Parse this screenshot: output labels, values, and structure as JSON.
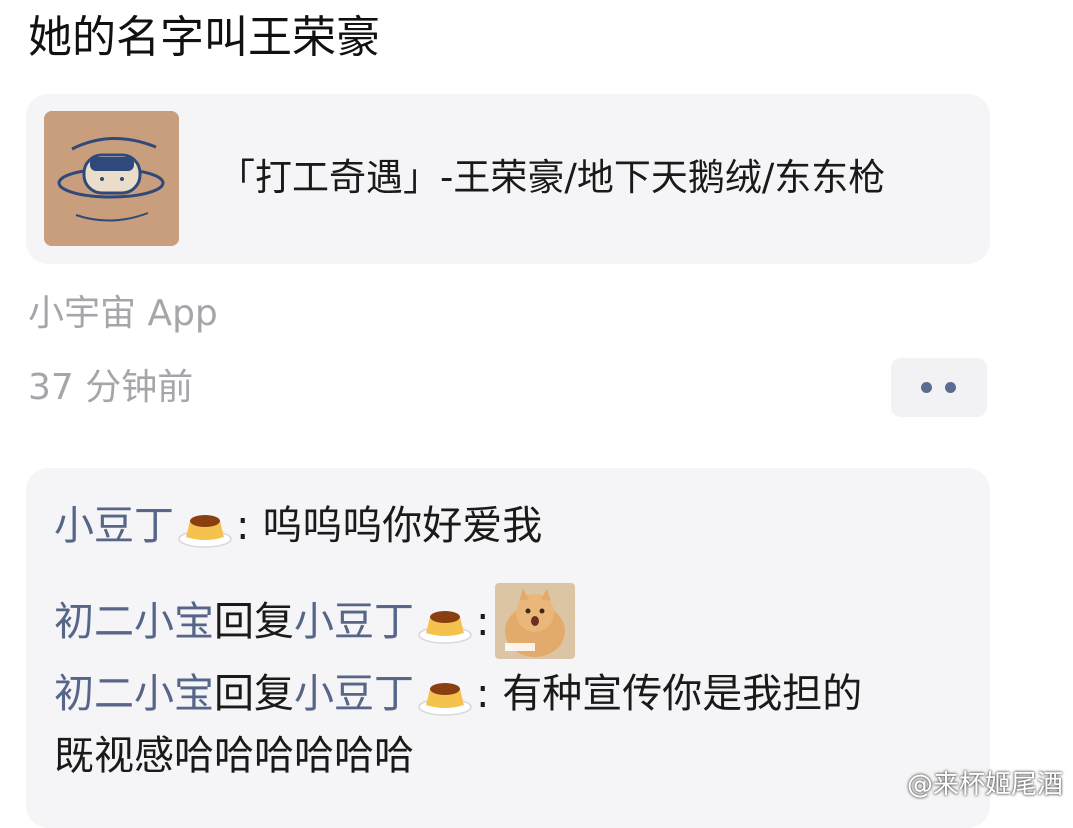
{
  "post": {
    "text": "她的名字叫王荣豪"
  },
  "music_card": {
    "title": "「打工奇遇」-王荣豪/地下天鹅绒/东东枪"
  },
  "meta": {
    "source": "小宇宙 App",
    "time": "37 分钟前",
    "more_icon": "more-dots-icon"
  },
  "comments": [
    {
      "user": "小豆丁",
      "sep": ": ",
      "text": "呜呜呜你好爱我"
    },
    {
      "user": "初二小宝",
      "reply_word": "回复",
      "reply_to": "小豆丁",
      "sep": ":",
      "sticker": "cat-sticker"
    },
    {
      "user": "初二小宝",
      "reply_word": "回复",
      "reply_to": "小豆丁",
      "sep": ": ",
      "text_line1": "有种宣传你是我担的",
      "text_line2": "既视感哈哈哈哈哈哈"
    }
  ],
  "watermark": "@来杯姬尾酒",
  "colors": {
    "username": "#566588",
    "meta_gray": "#a5a5aa",
    "card_bg": "#f5f5f7"
  }
}
